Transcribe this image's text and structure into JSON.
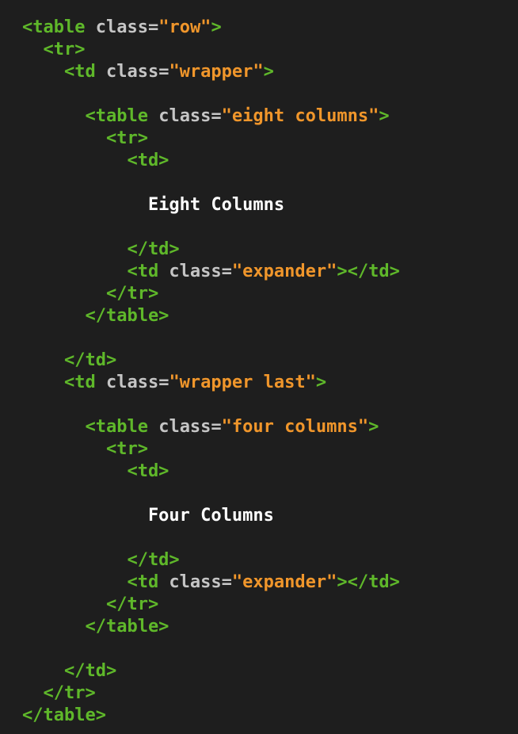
{
  "editor": {
    "background": "#1e1e1e",
    "colors": {
      "tag": "#5fb82a",
      "attribute": "#c5c5c5",
      "string": "#f0962b",
      "text": "#ffffff"
    },
    "lines": [
      [
        {
          "t": "<table",
          "k": "tag"
        },
        {
          "t": " class=",
          "k": "attr"
        },
        {
          "t": "\"row\"",
          "k": "string"
        },
        {
          "t": ">",
          "k": "tag"
        }
      ],
      [
        {
          "t": "  <tr>",
          "k": "tag"
        }
      ],
      [
        {
          "t": "    <td",
          "k": "tag"
        },
        {
          "t": " class=",
          "k": "attr"
        },
        {
          "t": "\"wrapper\"",
          "k": "string"
        },
        {
          "t": ">",
          "k": "tag"
        }
      ],
      [],
      [
        {
          "t": "      <table",
          "k": "tag"
        },
        {
          "t": " class=",
          "k": "attr"
        },
        {
          "t": "\"eight columns\"",
          "k": "string"
        },
        {
          "t": ">",
          "k": "tag"
        }
      ],
      [
        {
          "t": "        <tr>",
          "k": "tag"
        }
      ],
      [
        {
          "t": "          <td>",
          "k": "tag"
        }
      ],
      [],
      [
        {
          "t": "            Eight Columns",
          "k": "text"
        }
      ],
      [],
      [
        {
          "t": "          </td>",
          "k": "tag"
        }
      ],
      [
        {
          "t": "          <td",
          "k": "tag"
        },
        {
          "t": " class=",
          "k": "attr"
        },
        {
          "t": "\"expander\"",
          "k": "string"
        },
        {
          "t": "></td>",
          "k": "tag"
        }
      ],
      [
        {
          "t": "        </tr>",
          "k": "tag"
        }
      ],
      [
        {
          "t": "      </table>",
          "k": "tag"
        }
      ],
      [],
      [
        {
          "t": "    </td>",
          "k": "tag"
        }
      ],
      [
        {
          "t": "    <td",
          "k": "tag"
        },
        {
          "t": " class=",
          "k": "attr"
        },
        {
          "t": "\"wrapper last\"",
          "k": "string"
        },
        {
          "t": ">",
          "k": "tag"
        }
      ],
      [],
      [
        {
          "t": "      <table",
          "k": "tag"
        },
        {
          "t": " class=",
          "k": "attr"
        },
        {
          "t": "\"four columns\"",
          "k": "string"
        },
        {
          "t": ">",
          "k": "tag"
        }
      ],
      [
        {
          "t": "        <tr>",
          "k": "tag"
        }
      ],
      [
        {
          "t": "          <td>",
          "k": "tag"
        }
      ],
      [],
      [
        {
          "t": "            Four Columns",
          "k": "text"
        }
      ],
      [],
      [
        {
          "t": "          </td>",
          "k": "tag"
        }
      ],
      [
        {
          "t": "          <td",
          "k": "tag"
        },
        {
          "t": " class=",
          "k": "attr"
        },
        {
          "t": "\"expander\"",
          "k": "string"
        },
        {
          "t": "></td>",
          "k": "tag"
        }
      ],
      [
        {
          "t": "        </tr>",
          "k": "tag"
        }
      ],
      [
        {
          "t": "      </table>",
          "k": "tag"
        }
      ],
      [],
      [
        {
          "t": "    </td>",
          "k": "tag"
        }
      ],
      [
        {
          "t": "  </tr>",
          "k": "tag"
        }
      ],
      [
        {
          "t": "</table>",
          "k": "tag"
        }
      ]
    ]
  }
}
